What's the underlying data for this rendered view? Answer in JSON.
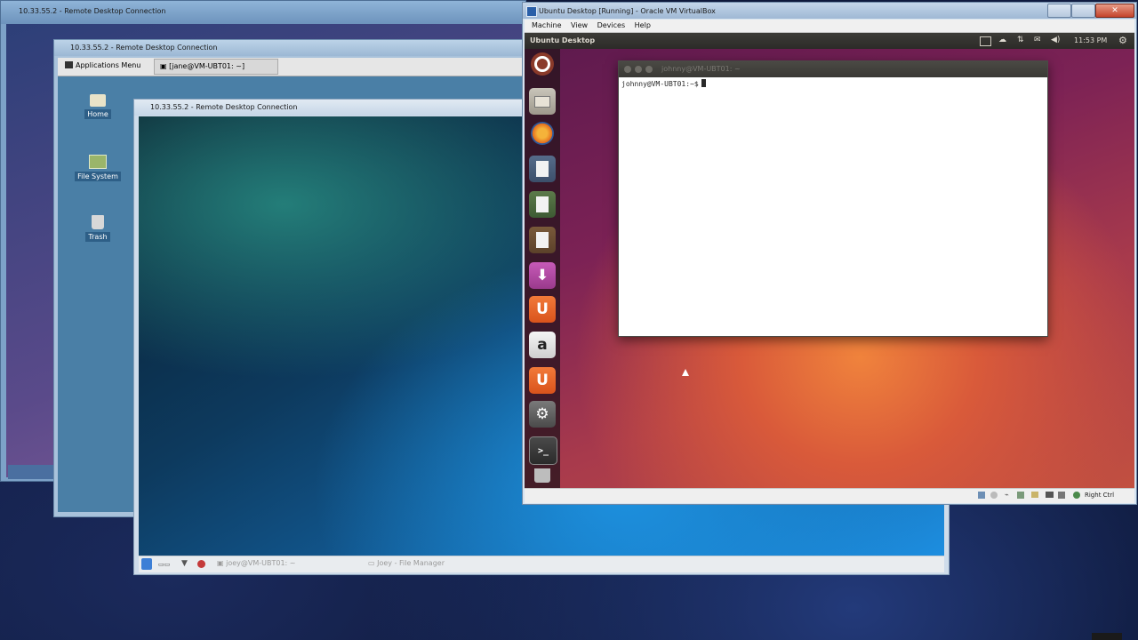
{
  "rdp_back": {
    "title": "10.33.55.2 - Remote Desktop Connection"
  },
  "rdp_xfce": {
    "title": "10.33.55.2 - Remote Desktop Connection",
    "panel": {
      "menu_label": "Applications Menu",
      "task_label": "[jane@VM-UBT01: ~]"
    },
    "desktop_icons": [
      {
        "label": "Home",
        "icon": "folder-icon"
      },
      {
        "label": "File System",
        "icon": "drive-icon"
      },
      {
        "label": "Trash",
        "icon": "trash-icon"
      }
    ]
  },
  "rdp_kde": {
    "title": "10.33.55.2 - Remote Desktop Connection",
    "panel": {
      "task1": "joey@VM-UBT01: ~",
      "task2": "Joey - File Manager"
    }
  },
  "vbox": {
    "title": "Ubuntu Desktop [Running] - Oracle VM VirtualBox",
    "menu": [
      "Machine",
      "View",
      "Devices",
      "Help"
    ],
    "status_host_key": "Right Ctrl"
  },
  "ubuntu": {
    "top_bar_title": "Ubuntu Desktop",
    "clock": "11:53 PM",
    "launcher": [
      {
        "name": "dash-icon"
      },
      {
        "name": "files-icon"
      },
      {
        "name": "firefox-icon"
      },
      {
        "name": "writer-icon"
      },
      {
        "name": "calc-icon"
      },
      {
        "name": "impress-icon"
      },
      {
        "name": "software-center-icon"
      },
      {
        "name": "ubuntu-one-icon"
      },
      {
        "name": "amazon-icon",
        "glyph": "a"
      },
      {
        "name": "ubuntu-one-music-icon"
      },
      {
        "name": "settings-icon",
        "glyph": "⚙"
      },
      {
        "name": "terminal-icon",
        "glyph": ">_"
      }
    ]
  },
  "terminal": {
    "title": "johnny@VM-UBT01: ~",
    "prompt": "johnny@VM-UBT01:~$"
  },
  "colors": {
    "ubuntu_orange": "#dd4814",
    "launcher_bg": "#2b1a24"
  }
}
